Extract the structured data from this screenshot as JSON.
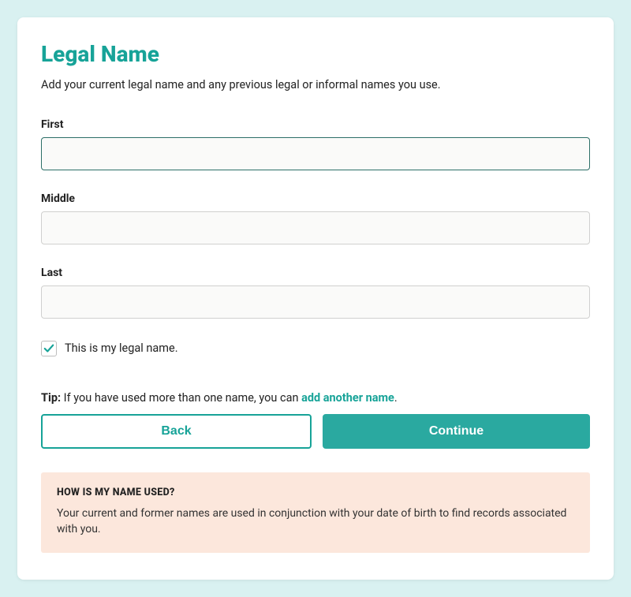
{
  "title": "Legal Name",
  "subtitle": "Add your current legal name and any previous legal or informal names you use.",
  "fields": {
    "first": {
      "label": "First",
      "value": ""
    },
    "middle": {
      "label": "Middle",
      "value": ""
    },
    "last": {
      "label": "Last",
      "value": ""
    }
  },
  "checkbox": {
    "label": "This is my legal name.",
    "checked": true
  },
  "tip": {
    "prefix": "Tip:",
    "text": " If you have used more than one name, you can ",
    "link": "add another name",
    "suffix": "."
  },
  "buttons": {
    "back": "Back",
    "continue": "Continue"
  },
  "info": {
    "title": "HOW IS MY NAME USED?",
    "body": "Your current and former names are used in conjunction with your date of birth to find records associated with you."
  }
}
